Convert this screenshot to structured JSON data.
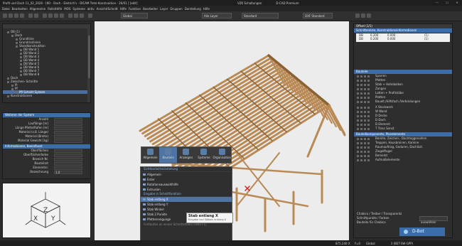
{
  "titlebar": {
    "title": "Profil und Dach 11_02_2026 - [KO - Dach - Dietrich's - DICAM Trete Konstruktion - 26/01 ] [edit]",
    "center1": "VZK Schaltungen",
    "center2": "D-CAD Premium",
    "min": "—",
    "max": "☐",
    "close": "✕"
  },
  "menubar": {
    "items": [
      "Datei",
      "Bearbeiten",
      "Allgemeine",
      "Rolle/Hilfe",
      "MOS",
      "Systeme",
      "aktiv",
      "Ansicht/Schnitt",
      "Hilfe",
      "Funktion",
      "Bearbeiter",
      "Layer",
      "Gruppen",
      "Darstellung",
      "Hilfe"
    ]
  },
  "toolbar": {
    "combo1": "Global",
    "combo2": "Alle Layer",
    "combo3": "Standard",
    "combo4": "DXF Standard"
  },
  "tree_panel": {
    "items": [
      {
        "label": "DB (1)",
        "indent": 1,
        "selected": false
      },
      {
        "label": "Dach",
        "indent": 2,
        "selected": false
      },
      {
        "label": "Grundlinie",
        "indent": 3,
        "selected": false
      },
      {
        "label": "Grundrisslinien",
        "indent": 3,
        "selected": false
      },
      {
        "label": "Standkonstruktion",
        "indent": 3,
        "selected": false
      },
      {
        "label": "DB Wand 1",
        "indent": 4,
        "selected": false
      },
      {
        "label": "DB Wand 2",
        "indent": 4,
        "selected": false
      },
      {
        "label": "DB Wand 3",
        "indent": 4,
        "selected": false
      },
      {
        "label": "DB Wand 4",
        "indent": 4,
        "selected": false
      },
      {
        "label": "DB Wand 5",
        "indent": 4,
        "selected": false
      },
      {
        "label": "DB Wand 6",
        "indent": 4,
        "selected": false
      },
      {
        "label": "DB Wand 7",
        "indent": 4,
        "selected": false
      },
      {
        "label": "DB Wand 8",
        "indent": 4,
        "selected": false
      },
      {
        "label": "Dach",
        "indent": 1,
        "selected": false
      },
      {
        "label": "Zwischen- Schnitte",
        "indent": 1,
        "selected": false
      },
      {
        "label": "Pl",
        "indent": 2,
        "selected": false
      },
      {
        "label": "Pf",
        "indent": 2,
        "selected": false
      },
      {
        "label": "Pfl Schnitt System",
        "indent": 3,
        "selected": true
      },
      {
        "label": "Konstruktionen",
        "indent": 1,
        "selected": false
      }
    ]
  },
  "props_panel": {
    "header1": "Weiterer der System",
    "rows1": [
      {
        "label": "Anzahl",
        "value": ""
      },
      {
        "label": "Lauflänge [m]",
        "value": ""
      },
      {
        "label": "Länge Pfette/Rafen [m]",
        "value": ""
      },
      {
        "label": "Material (z.B. Länge)",
        "value": ""
      },
      {
        "label": "Material (Breite)",
        "value": ""
      },
      {
        "label": "Material Gewicht [kg]",
        "value": ""
      }
    ],
    "header2": "Informationen, Beeinflusst",
    "rows2": [
      {
        "label": "Oberflächen",
        "value": ""
      },
      {
        "label": "Oberflächenfarbe",
        "value": ""
      },
      {
        "label": "Bezeich Nr.",
        "value": ""
      },
      {
        "label": "Bauteilart",
        "value": ""
      },
      {
        "label": "Elementnr.",
        "value": ""
      },
      {
        "label": "Bezeichnung",
        "value": "1,0"
      }
    ]
  },
  "viewcube": {
    "label_x": "X",
    "label_y": "Y",
    "label_z": "Z"
  },
  "context_menu": {
    "tabs": [
      {
        "label": "Allgemein",
        "active": false
      },
      {
        "label": "Bauteile",
        "active": true
      },
      {
        "label": "Anzeigen",
        "active": false
      },
      {
        "label": "Systeme",
        "active": false
      },
      {
        "label": "Organisation",
        "active": false
      }
    ],
    "section1": "Sichtbarkeitseinstellung",
    "items1": [
      "Allgemein",
      "Enter",
      "Rotationsauswahlhilfe",
      "Extrusion"
    ],
    "section2": "Eingabe in Schnittfunktion",
    "items2": [
      "Stab entlang X",
      "Stab entlang Y",
      "Stab Winkel",
      "Stab 2 Punkte",
      "Pfettenneigunge"
    ],
    "highlighted": "Stab entlang X",
    "footer": "Fortlaufen an einem Schnittstellen (Hilfe F1)"
  },
  "tooltip": {
    "title": "Stab entlang X",
    "desc": "Eingabe von Stäben entlang X"
  },
  "right_panel": {
    "title": "Offset (1/1)",
    "header1": "Schnittenliste, Konstruktionsinformationen",
    "grid_rows": [
      {
        "a": "DB",
        "b": "0.200",
        "c": "0.000",
        "d": "(1)"
      },
      {
        "a": "DB",
        "b": "0.200",
        "c": "0.000",
        "d": "(1)"
      }
    ],
    "header2": "Bauteile",
    "bauteile": [
      "Sparren",
      "Pfetten",
      "Stab + Hahnbalken",
      "Zangen",
      "Latten + Profilstäbe",
      "Platten",
      "Bauelt./Hilfsfach./Verbindungen"
    ],
    "views": [
      "X Stockwerk",
      "W Wand",
      "D Decke",
      "D Dach",
      "D Element",
      "T Trass Sonst."
    ],
    "header3": "Bauteilkomponente, Planelemente",
    "planelem": [
      "Bereite, Zeichen-, Dachteggenahlen",
      "Treppen, Hausbroinen, Kamine",
      "Raumauftrag, Goduren, Dachlüst.",
      "Ziegelflugel",
      "Bemerkt",
      "Aufmaßelemente"
    ],
    "bottom_label1": "Chabico / Treiber / Transparentz",
    "bottom_label2": "Schnittpunkte / Farben",
    "bottom_value": "",
    "bottom_label3": "Bauteile für Chabico",
    "bottom_label4": "auswählen"
  },
  "dbot": {
    "label": "D-Bot"
  },
  "statusbar": {
    "coord": "875.240 X",
    "mode": "Y=0",
    "grid": "Global",
    "right": "3 (BET-SW-GPP)"
  }
}
